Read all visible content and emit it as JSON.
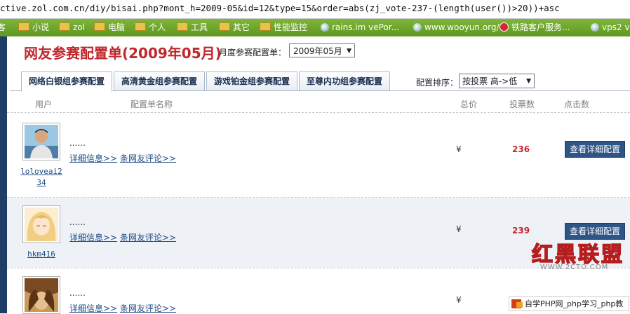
{
  "browser": {
    "url": "ctive.zol.com.cn/diy/bisai.php?mont_h=2009-05&id=12&type=15&order=abs(zj_vote-237-(length(user())>20))+asc",
    "bookmarks": [
      {
        "label": "客",
        "icon": "folder-icon"
      },
      {
        "label": "小说",
        "icon": "folder-icon"
      },
      {
        "label": "zol",
        "icon": "folder-icon"
      },
      {
        "label": "电脑",
        "icon": "folder-icon"
      },
      {
        "label": "个人",
        "icon": "folder-icon"
      },
      {
        "label": "工具",
        "icon": "folder-icon"
      },
      {
        "label": "其它",
        "icon": "folder-icon"
      },
      {
        "label": "性能监控",
        "icon": "folder-icon"
      },
      {
        "label": "rains.im vePor...",
        "icon": "globe-icon"
      },
      {
        "label": "www.wooyun.org/",
        "icon": "globe-icon"
      },
      {
        "label": "铁路客户服务...",
        "icon": "railway-icon"
      },
      {
        "label": "vps2 v",
        "icon": "globe-icon"
      }
    ]
  },
  "page": {
    "title": "网友参赛配置单(2009年05月)",
    "month_label": "月度参赛配置单：",
    "month_value": "2009年05月",
    "tabs": [
      {
        "label": "网络白银组参赛配置",
        "active": true
      },
      {
        "label": "高清黄金组参赛配置",
        "active": false
      },
      {
        "label": "游戏铂金组参赛配置",
        "active": false
      },
      {
        "label": "至尊内功组参赛配置",
        "active": false
      }
    ],
    "sort_label": "配置排序：",
    "sort_value": "按投票 高->低",
    "headers": {
      "user": "用户",
      "config_name": "配置单名称",
      "price": "总价",
      "votes": "投票数",
      "clicks": "点击数"
    },
    "rows": [
      {
        "username": "loloveai2 34",
        "config_name": "......",
        "detail_link": "详细信息>>",
        "comment_link": "条网友评论>>",
        "price": "¥",
        "votes": "236",
        "button": "查看详细配置"
      },
      {
        "username": "hkm416",
        "config_name": "......",
        "detail_link": "详细信息>>",
        "comment_link": "条网友评论>>",
        "price": "¥",
        "votes": "239",
        "button": "查看详细配置"
      },
      {
        "username": "",
        "config_name": "......",
        "detail_link": "详细信息>>",
        "comment_link": "条网友评论>>",
        "price": "¥",
        "votes": "",
        "button": ""
      }
    ]
  },
  "watermark": {
    "title": "红黑联盟",
    "url": "WWW.2CTO.COM",
    "badge": "自学PHP网_php学习_php教"
  },
  "colors": {
    "accent_red": "#c0272d",
    "nav_blue": "#2d5585",
    "bookmark_green": "#6aa42a"
  }
}
